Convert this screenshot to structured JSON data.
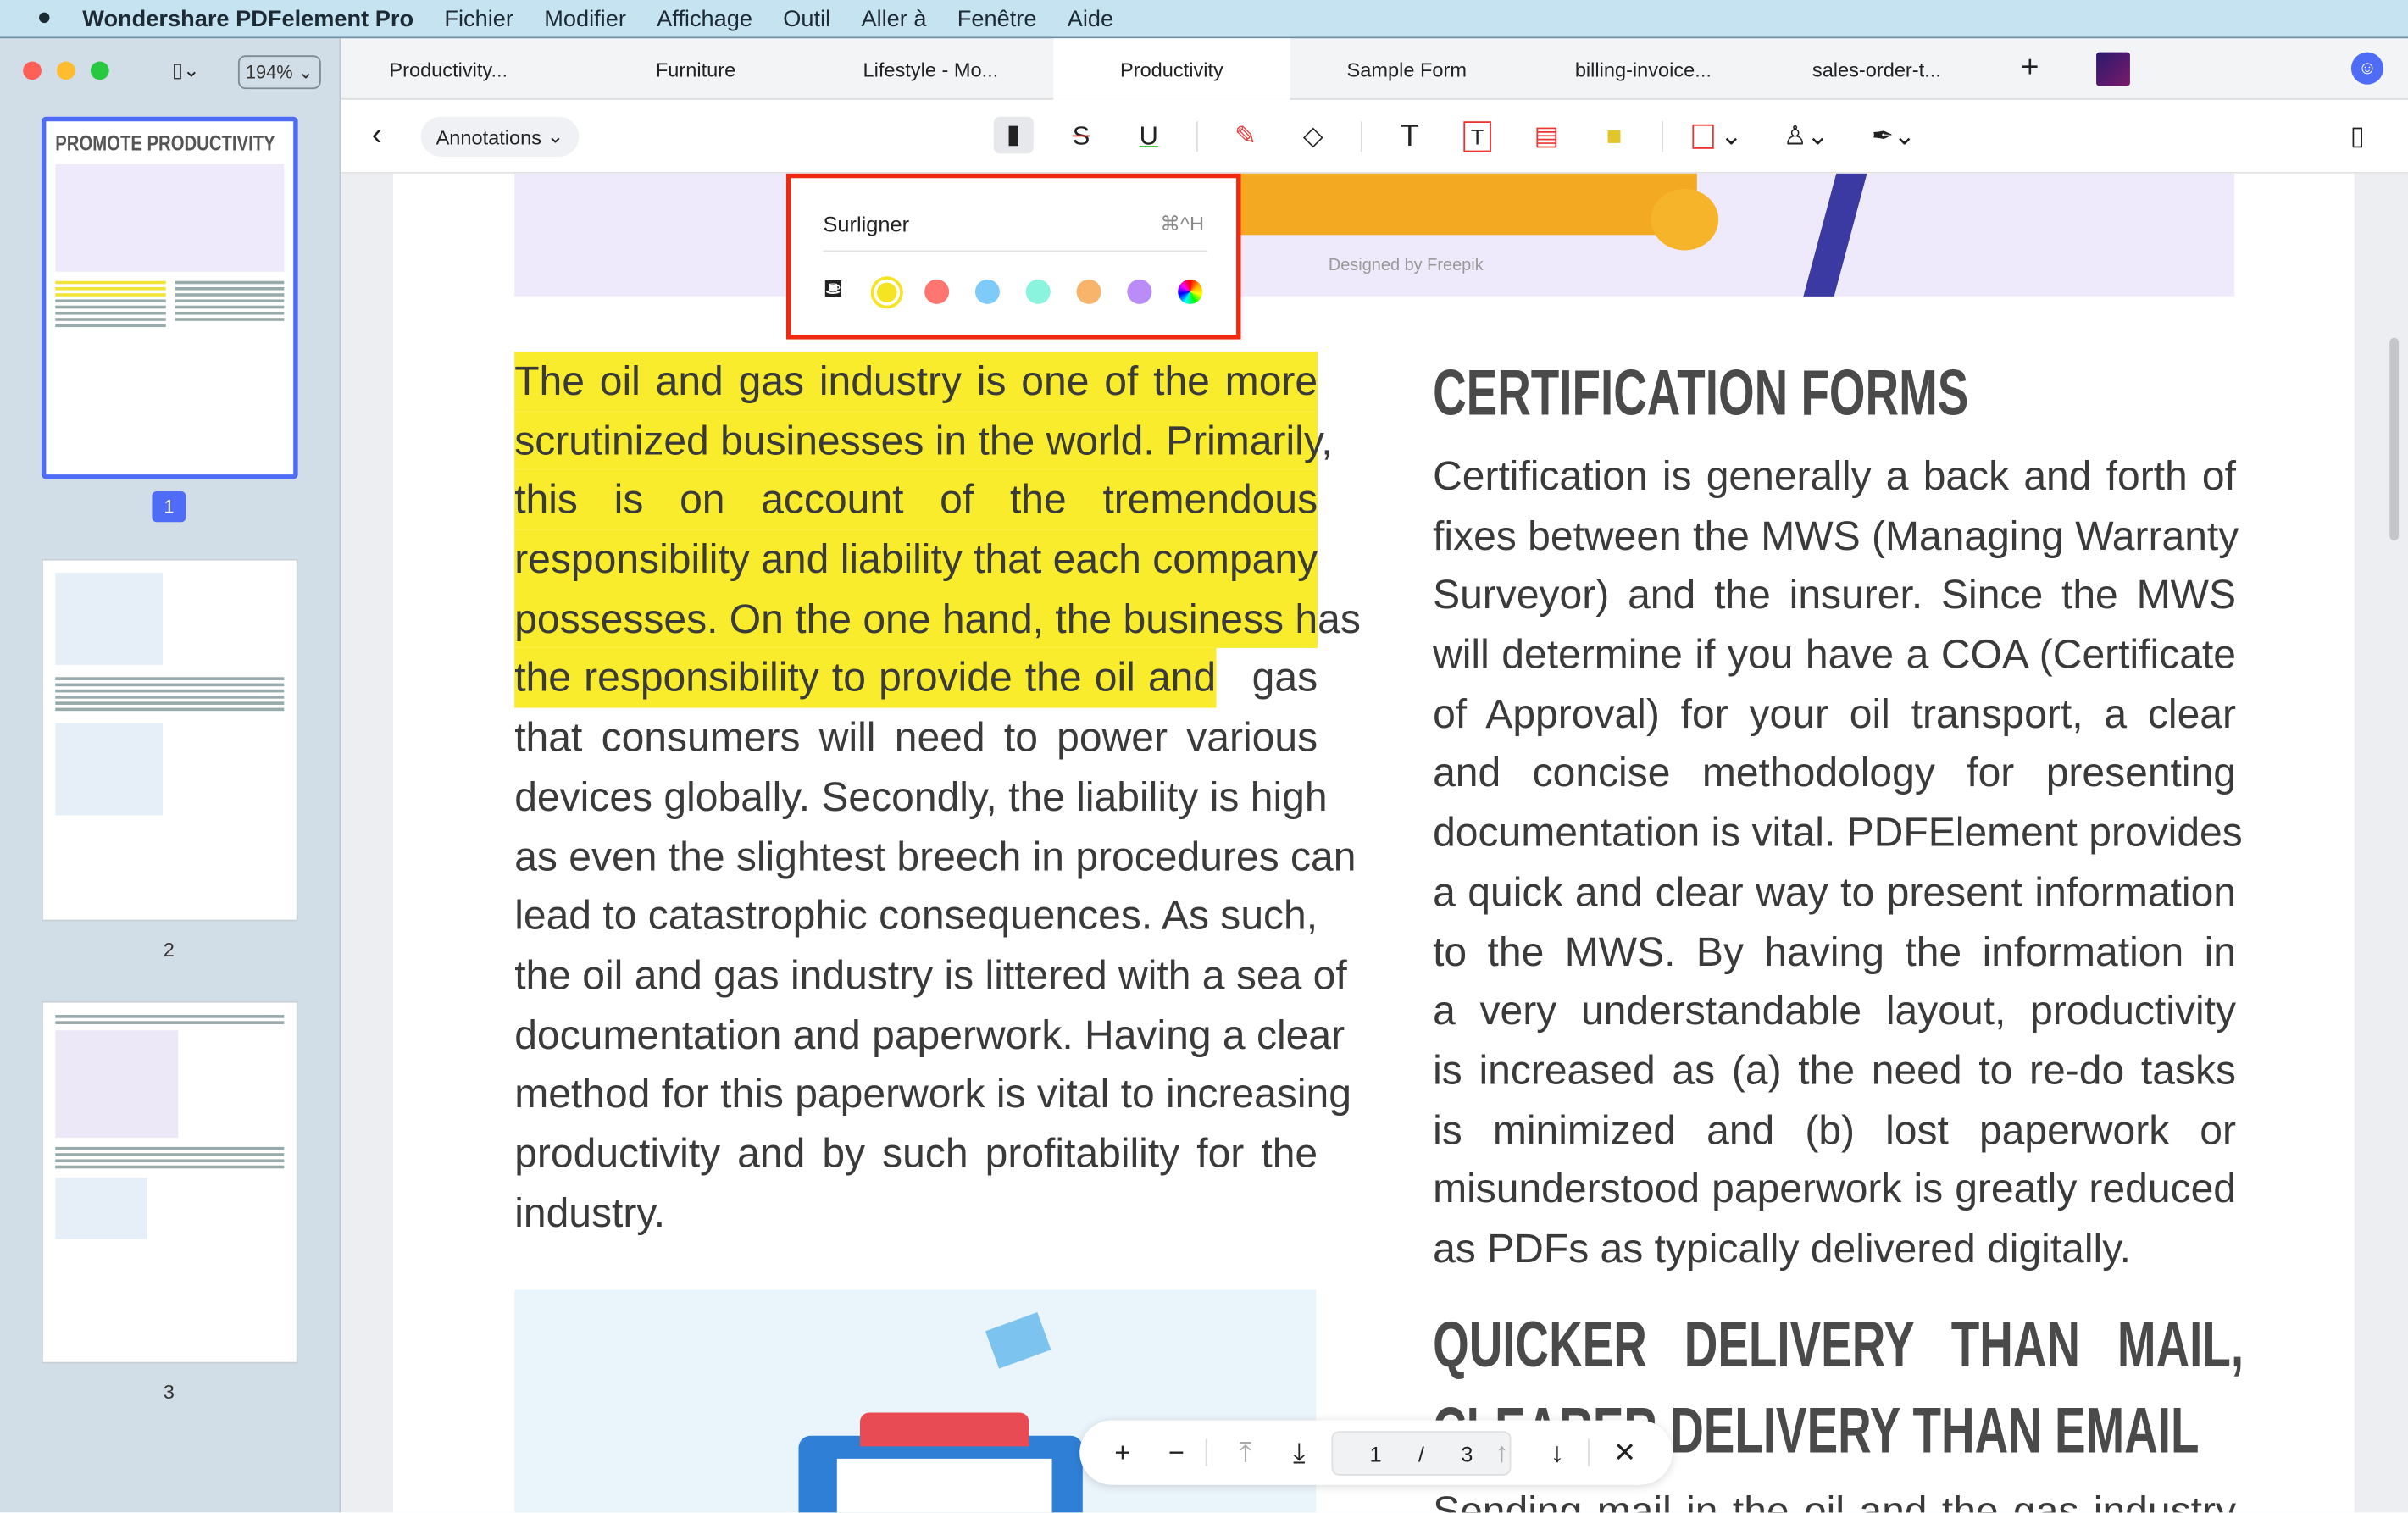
{
  "menubar": {
    "app": "Wondershare PDFelement Pro",
    "items": [
      "Fichier",
      "Modifier",
      "Affichage",
      "Outil",
      "Aller à",
      "Fenêtre",
      "Aide"
    ]
  },
  "sidebar": {
    "zoom": "194%",
    "thumb1_title": "PROMOTE PRODUCTIVITY",
    "pages": [
      "1",
      "2",
      "3"
    ],
    "selected_page": 1
  },
  "tabs": [
    {
      "label": "Productivity..."
    },
    {
      "label": "Furniture"
    },
    {
      "label": "Lifestyle - Mo..."
    },
    {
      "label": "Productivity",
      "active": true
    },
    {
      "label": "Sample Form"
    },
    {
      "label": "billing-invoice..."
    },
    {
      "label": "sales-order-t..."
    }
  ],
  "toolbar": {
    "mode": "Annotations",
    "icons": [
      "highlight-icon",
      "strikethrough-icon",
      "underline-icon",
      "marker-icon",
      "eraser-icon",
      "text-icon",
      "textbox-icon",
      "callout-icon",
      "sticky-note-icon",
      "rectangle-icon",
      "stamp-icon",
      "pen-icon"
    ]
  },
  "popup": {
    "title": "Surligner",
    "shortcut": "⌘^H",
    "colors": [
      "#f5e424",
      "#ff7670",
      "#7ecbfa",
      "#8af4de",
      "#f8b46a",
      "#b98cf8"
    ],
    "selected_color": "#f5e424"
  },
  "page": {
    "image_credit": "Designed by Freepik",
    "left_lines": [
      "The oil and gas industry is one of the more",
      "scrutinized businesses in the world. Primarily,",
      "this is on account of the tremendous",
      "responsibility and liability that each company",
      "possesses. On the one hand, the business has"
    ],
    "left_line6_hl": "the responsibility to provide the oil and",
    "left_line6_rest": " gas",
    "left_rest": [
      "that consumers will need to power various",
      "devices globally. Secondly, the liability is high",
      "as even the slightest breech in procedures can",
      "lead to catastrophic consequences. As such,",
      "the oil and gas industry is littered with a sea of",
      "documentation and paperwork. Having a clear",
      "method for this paperwork is vital to increasing",
      "productivity and by such profitability for the",
      "industry."
    ],
    "heading1": "CERTIFICATION FORMS",
    "right_lines": [
      "Certification is generally a back and forth of",
      "fixes between the MWS (Managing Warranty",
      "Surveyor) and the insurer. Since the MWS",
      "will determine if you have a COA (Certificate",
      "of Approval) for your oil transport, a clear",
      "and concise methodology for presenting",
      "documentation is vital. PDFElement provides",
      "a quick and clear way to present information",
      "to the MWS. By having the information in",
      "a very understandable layout, productivity",
      "is increased as (a) the need to re-do tasks",
      "is minimized and (b) lost paperwork or",
      "misunderstood paperwork is greatly reduced",
      "as PDFs as typically delivered digitally."
    ],
    "heading2a": "QUICKER DELIVERY THAN MAIL,",
    "heading2b": "CLEARER DELIVERY THAN EMAIL",
    "right_tail": "Sending mail in the oil and the gas industry"
  },
  "pager": {
    "current": "1",
    "sep": "/",
    "total": "3"
  }
}
